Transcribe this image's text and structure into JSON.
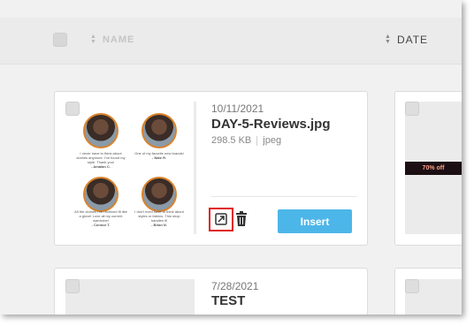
{
  "header": {
    "name_label": "NAME",
    "date_label": "DATE"
  },
  "cards": [
    {
      "date": "10/11/2021",
      "filename": "DAY-5-Reviews.jpg",
      "size": "298.5 KB",
      "filetype": "jpeg",
      "insert_label": "Insert",
      "thumbnail_quotes": [
        {
          "text": "I never have to think about clothes anymore. I've found my style. Thank you!",
          "author": "- Amalan C."
        },
        {
          "text": "One of my favorite new brands!",
          "author": "- Nate R."
        },
        {
          "text": "All the clothes I've received fit like a glove! Love all my current wardrobe!",
          "author": "- Connor T."
        },
        {
          "text": "I don't even have to think about styles or fabrics. This shop handles it!",
          "author": "- Brian N."
        }
      ]
    },
    {
      "date": "7/28/2021",
      "filename": "TEST"
    }
  ],
  "right_card": {
    "promo_text": "70% off"
  },
  "colors": {
    "accent": "#4db6e9",
    "highlight_border": "#e02020",
    "avatar_ring": "#d9822b"
  },
  "icons": {
    "open": "external-link-icon",
    "delete": "trash-icon"
  }
}
